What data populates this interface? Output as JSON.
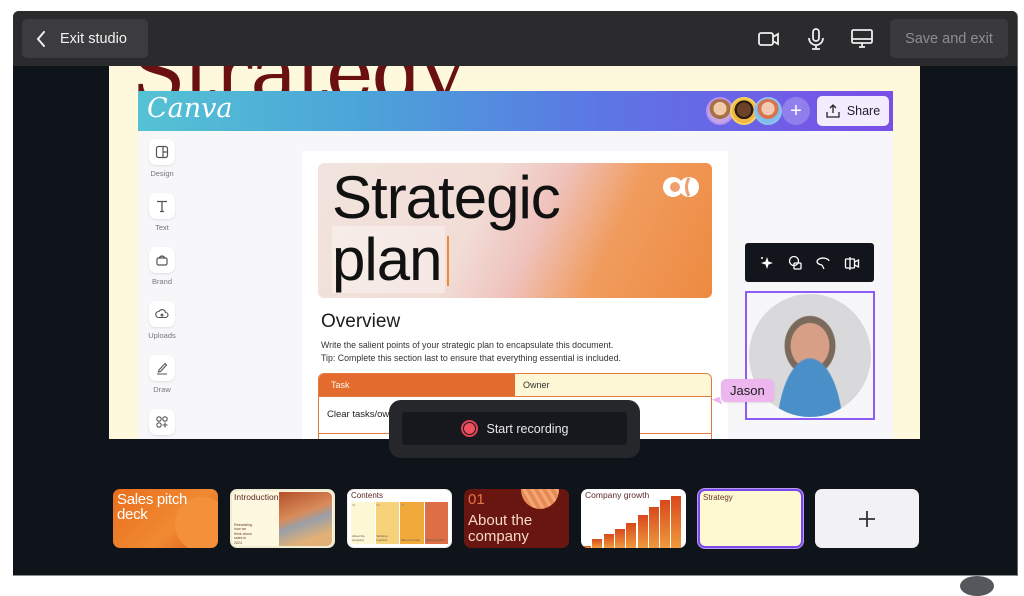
{
  "topbar": {
    "exit_label": "Exit studio",
    "icons": [
      "camera-icon",
      "microphone-icon",
      "screen-share-icon"
    ],
    "save_label": "Save and exit"
  },
  "stage": {
    "background_title": "Strategy",
    "editor": {
      "logo": "Canva",
      "share_label": "Share",
      "collaborators": [
        "Collaborator 1",
        "Collaborator 2",
        "Collaborator 3"
      ],
      "add_collaborator": "+",
      "rail": [
        {
          "label": "Design",
          "icon": "layout-icon"
        },
        {
          "label": "Text",
          "icon": "text-icon"
        },
        {
          "label": "Brand",
          "icon": "brand-icon"
        },
        {
          "label": "Uploads",
          "icon": "upload-cloud-icon"
        },
        {
          "label": "Draw",
          "icon": "pen-icon"
        },
        {
          "label": "",
          "icon": "apps-icon"
        }
      ],
      "document": {
        "hero_line1": "Strategic",
        "hero_line2": "plan",
        "overview_title": "Overview",
        "overview_line1": "Write the salient points of your strategic plan to encapsulate this document.",
        "overview_line2": "Tip: Complete this section last to ensure that everything essential is included.",
        "table": {
          "headers": [
            "Task",
            "Owner"
          ],
          "rows": [
            [
              "Clear tasks/ow",
              ""
            ]
          ]
        }
      },
      "presenter_name": "Jason"
    }
  },
  "recording": {
    "label": "Start recording"
  },
  "filmstrip": [
    {
      "title": "Sales pitch deck"
    },
    {
      "title": "Introduction",
      "subtitle": "Reinstating how we think about sales in 2024"
    },
    {
      "title": "Contents",
      "columns": [
        {
          "num": "01",
          "label": "About the company",
          "color": "#fdf7d4"
        },
        {
          "num": "02",
          "label": "Working together",
          "color": "#f8d27a"
        },
        {
          "num": "03",
          "label": "Meet the team",
          "color": "#f2a93c"
        },
        {
          "num": "04",
          "label": "Sales forecast",
          "color": "#de6e46"
        }
      ]
    },
    {
      "num": "01",
      "title": "About the company"
    },
    {
      "title": "Company growth",
      "bars": [
        0.04,
        0.18,
        0.26,
        0.36,
        0.48,
        0.64,
        0.78,
        0.92,
        1.0
      ]
    },
    {
      "title": "Strategy",
      "selected": true
    }
  ],
  "add_page_label": "+"
}
